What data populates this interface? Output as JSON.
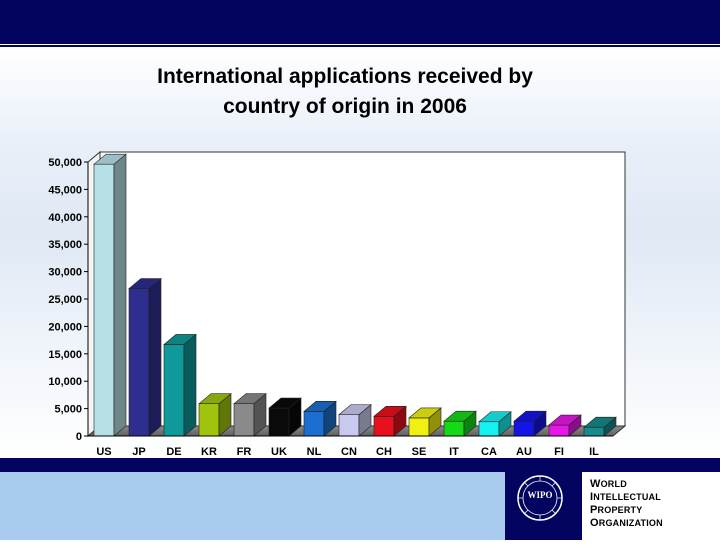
{
  "slide": {
    "title": "International applications received by country of origin in 2006",
    "title_line1": "International applications received by",
    "title_line2": "country of origin in 2006"
  },
  "organization": {
    "logo_text": "WIPO",
    "line1_initial": "W",
    "line1_rest": "ORLD",
    "line2_initial": "I",
    "line2_rest": "NTELLECTUAL",
    "line3_initial": "P",
    "line3_rest": "ROPERTY",
    "line4_initial": "O",
    "line4_rest": "RGANIZATION"
  },
  "colors": {
    "header_bar": "#020460",
    "footer_left": "#a9cbee"
  },
  "chart_data": {
    "type": "bar",
    "title": "International applications received by country of origin in 2006",
    "categories": [
      "US",
      "JP",
      "DE",
      "KR",
      "FR",
      "UK",
      "NL",
      "CN",
      "CH",
      "SE",
      "IT",
      "CA",
      "AU",
      "FI",
      "IL"
    ],
    "values": [
      49600,
      26900,
      16700,
      5900,
      5900,
      5100,
      4500,
      3900,
      3600,
      3300,
      2700,
      2600,
      2700,
      2000,
      1600
    ],
    "ylim": [
      0,
      50000
    ],
    "yticks": [
      "0",
      "5,000",
      "10,000",
      "15,000",
      "20,000",
      "25,000",
      "30,000",
      "35,000",
      "40,000",
      "45,000",
      "50,000"
    ],
    "ytick_values": [
      0,
      5000,
      10000,
      15000,
      20000,
      25000,
      30000,
      35000,
      40000,
      45000,
      50000
    ],
    "colors": [
      "#b7e0e6",
      "#2e2e8f",
      "#0e9a9a",
      "#a0c40e",
      "#8a8a8a",
      "#0a0a0a",
      "#1c6fd0",
      "#c9c9f0",
      "#e8101c",
      "#f0f013",
      "#17d817",
      "#17f0f0",
      "#1414e8",
      "#e617e6",
      "#178a8a"
    ],
    "grid": false,
    "legend": "none"
  }
}
